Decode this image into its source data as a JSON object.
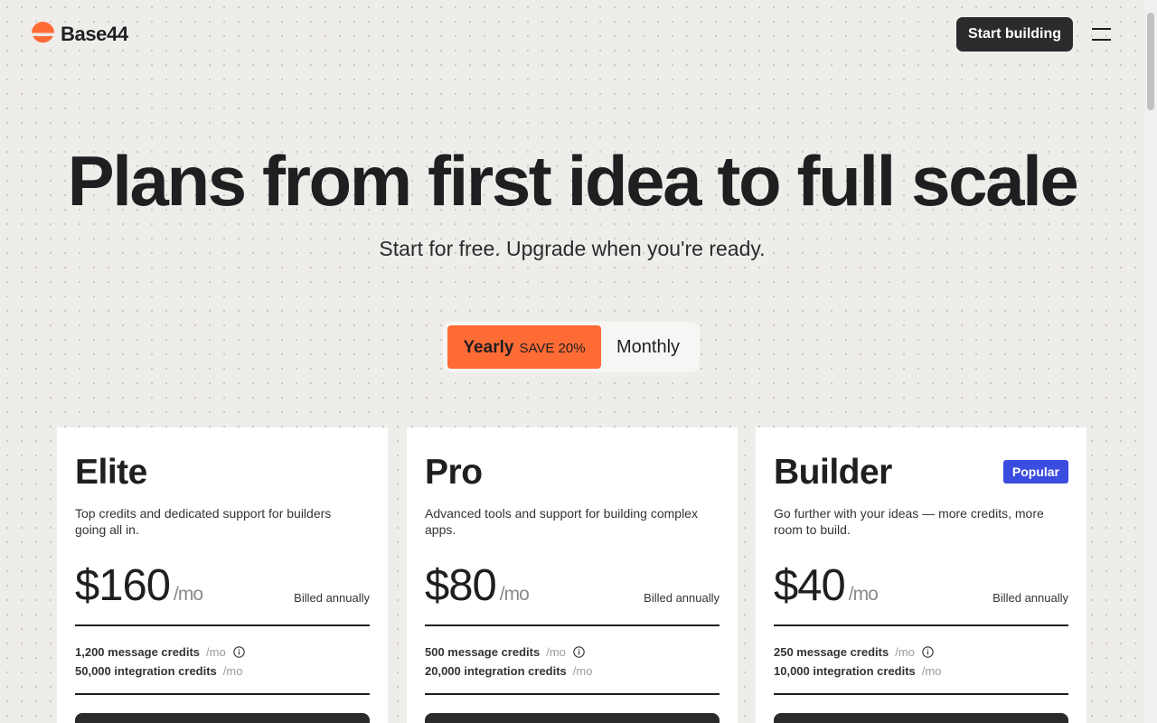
{
  "header": {
    "brand": "Base44",
    "start_button": "Start building",
    "logo_color": "#ff6b35"
  },
  "hero": {
    "title": "Plans from first idea to full scale",
    "subtitle": "Start for free. Upgrade when you're ready."
  },
  "billing_toggle": {
    "yearly_label": "Yearly",
    "yearly_badge": "SAVE 20%",
    "monthly_label": "Monthly",
    "selected": "Yearly",
    "active_color": "#ff6b35"
  },
  "plans": [
    {
      "name": "Elite",
      "description": "Top credits and dedicated support for builders going all in.",
      "price": "$160",
      "per": "/mo",
      "billed": "Billed annually",
      "message_credits": "1,200 message credits",
      "message_unit": "/mo",
      "integration_credits": "50,000 integration credits",
      "integration_unit": "/mo"
    },
    {
      "name": "Pro",
      "description": "Advanced tools and support for building complex apps.",
      "price": "$80",
      "per": "/mo",
      "billed": "Billed annually",
      "message_credits": "500 message credits",
      "message_unit": "/mo",
      "integration_credits": "20,000 integration credits",
      "integration_unit": "/mo"
    },
    {
      "name": "Builder",
      "badge": "Popular",
      "badge_color": "#3b4ce0",
      "description": "Go further with your ideas — more credits, more room to build.",
      "price": "$40",
      "per": "/mo",
      "billed": "Billed annually",
      "message_credits": "250 message credits",
      "message_unit": "/mo",
      "integration_credits": "10,000 integration credits",
      "integration_unit": "/mo"
    }
  ]
}
